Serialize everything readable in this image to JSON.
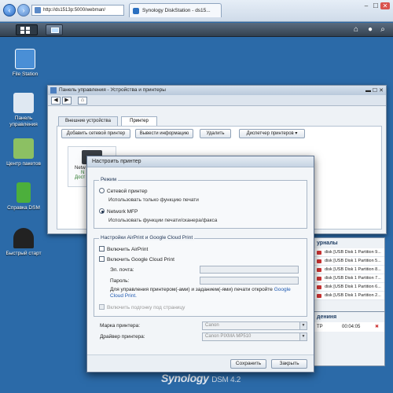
{
  "browser": {
    "address": "http://ds1513p:5000/webman/",
    "tab_title": "Synology DiskStation - ds15...",
    "controls": [
      "–",
      "☐",
      "✕"
    ]
  },
  "desktop": {
    "icons": [
      {
        "label": "File Station",
        "icon": "file-station-icon",
        "color": "#4a8fd6"
      },
      {
        "label": "Панель управления",
        "icon": "control-panel-icon",
        "color": "#dfe8f2"
      },
      {
        "label": "Центр пакетов",
        "icon": "package-center-icon",
        "color": "#8cc063"
      },
      {
        "label": "Справка DSM",
        "icon": "dsm-help-icon",
        "color": "#4caf3c"
      },
      {
        "label": "Быстрый старт",
        "icon": "quick-start-icon",
        "color": "#222"
      }
    ],
    "brand": "Synology",
    "brand_version": "DSM 4.2"
  },
  "control_panel": {
    "title": "Панель управления - Устройства и принтеры",
    "tabs": [
      "Внешние устройства",
      "Принтер"
    ],
    "buttons": [
      "Добавить сетевой принтер",
      "Вывести информацию",
      "Удалить",
      "Диспетчер принтеров"
    ],
    "printer_card": {
      "name": "Netw",
      "line2": "N",
      "line3": "Дост"
    }
  },
  "side_panel": {
    "title": "урналы",
    "rows": [
      "disk [USB Disk 1 Partition 9...",
      "disk [USB Disk 1 Partition 5...",
      "disk [USB Disk 1 Partition 8...",
      "disk [USB Disk 1 Partition 7...",
      "disk [USB Disk 1 Partition 6...",
      "disk [USB Disk 1 Partition 2..."
    ],
    "title2": "дениня",
    "row2_col1": "ТР",
    "row2_time": "00:04:05"
  },
  "dialog": {
    "title": "Настроить принтер",
    "mode_legend": "Режим",
    "mode_network": "Сетевой принтер",
    "mode_network_desc": "Использовать только функцию печати",
    "mode_mfp": "Network MFP",
    "mode_mfp_desc": "Использовать функции печати/сканера/факса",
    "airprint_legend": "Настройки AirPrint и Google Cloud Print",
    "enable_airprint": "Включить AirPrint",
    "enable_gcp": "Включить Google Cloud Print",
    "email_label": "Эл. почта:",
    "password_label": "Пароль:",
    "gcp_note_1": "Для управления принтером(-ами) и заданием(-ями) печати откройте",
    "gcp_note_link": "Google Cloud Print.",
    "fit_to_page": "Включить подгонку под страницу",
    "brand_label": "Марка принтера:",
    "brand_value": "Canon",
    "driver_label": "Драйвер принтера:",
    "driver_value": "Canon PIXMA MP510",
    "save": "Сохранить",
    "close": "Закрыть"
  }
}
